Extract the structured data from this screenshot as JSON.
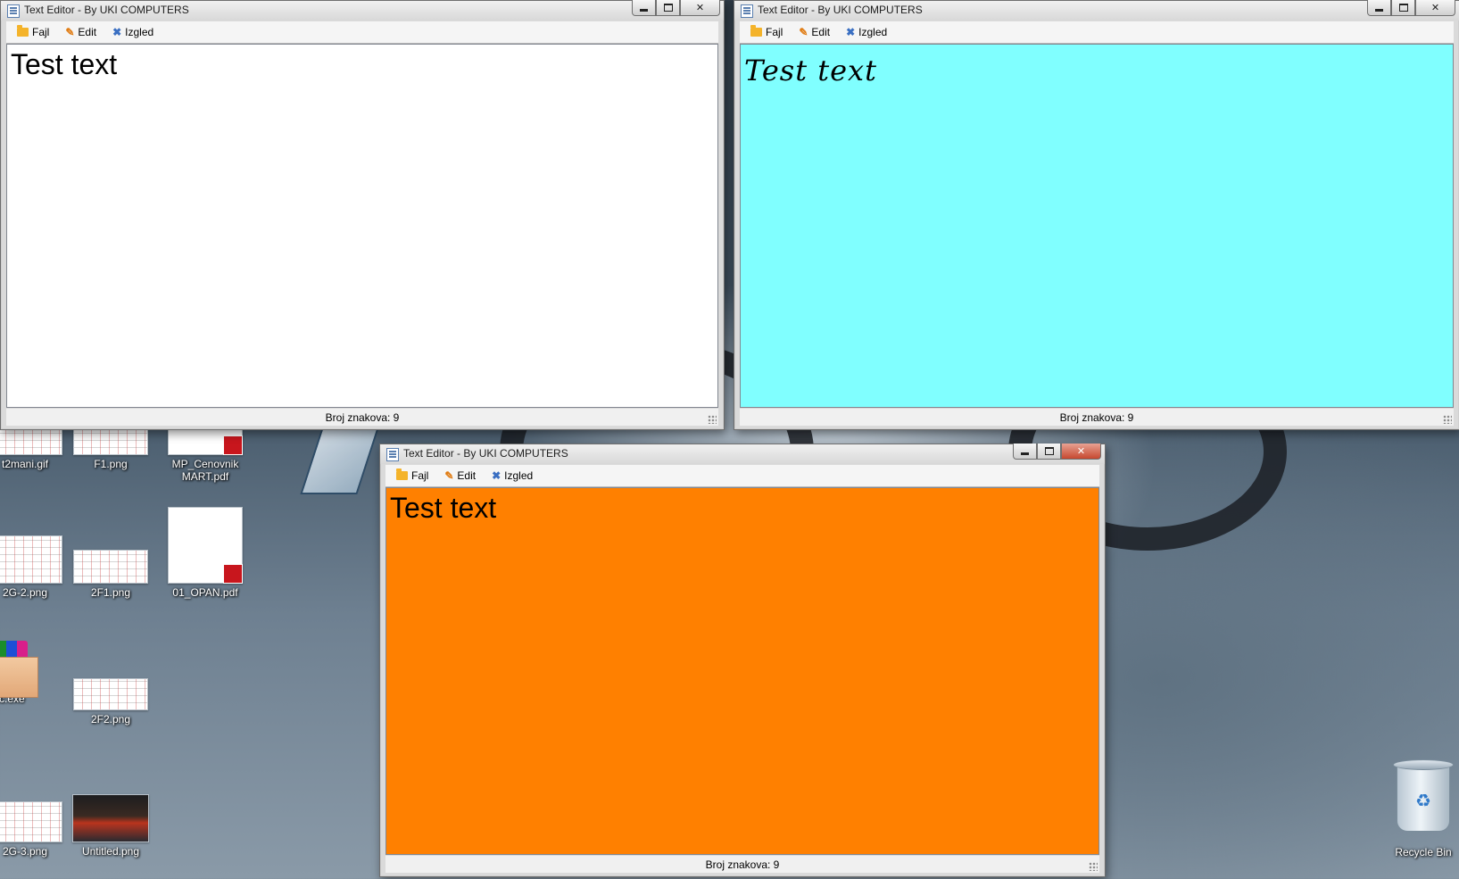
{
  "windows": [
    {
      "title": "Text Editor - By UKI COMPUTERS",
      "menu": [
        "Fajl",
        "Edit",
        "Izgled"
      ],
      "content": "Test text",
      "status": "Broj znakova: 9",
      "background": "#ffffff",
      "text_color": "#000000",
      "font_style": "sans-serif"
    },
    {
      "title": "Text Editor - By UKI COMPUTERS",
      "menu": [
        "Fajl",
        "Edit",
        "Izgled"
      ],
      "content": "Test text",
      "status": "Broj znakova: 9",
      "background": "#80ffff",
      "text_color": "#000000",
      "font_style": "handwriting"
    },
    {
      "title": "Text Editor - By UKI COMPUTERS",
      "menu": [
        "Fajl",
        "Edit",
        "Izgled"
      ],
      "content": "Test text",
      "status": "Broj znakova: 9",
      "background": "#ff8000",
      "text_color": "#000000",
      "font_style": "sans-serif",
      "active": true
    }
  ],
  "desktop": {
    "icons": [
      "t2mani.gif",
      "F1.png",
      "MP_Cenovnik MART.pdf",
      "2G-2.png",
      "2F1.png",
      "01_OPAN.pdf",
      "uc.exe",
      "2F2.png",
      "2G-3.png",
      "Untitled.png"
    ],
    "recycle_bin": "Recycle Bin"
  }
}
